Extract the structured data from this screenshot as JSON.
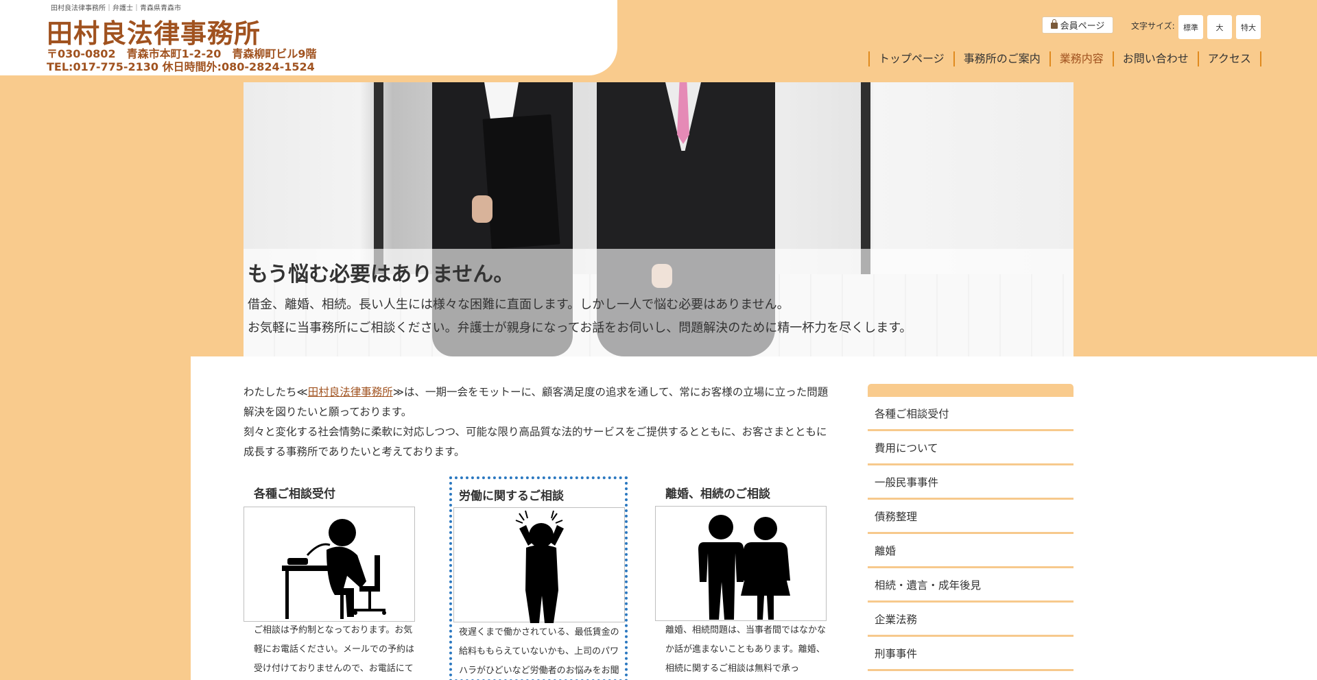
{
  "header": {
    "tagline": "田村良法律事務所｜弁護士｜青森県青森市",
    "title": "田村良法律事務所",
    "address": "〒030-0802　青森市本町1-2-20　青森柳町ビル9階",
    "tel": "TEL:017-775-2130 休日時間外:080-2824-1524",
    "member_label": "会員ページ",
    "font_size_label": "文字サイズ:",
    "font_sizes": [
      "標準",
      "大",
      "特大"
    ]
  },
  "nav": [
    "トップページ",
    "事務所のご案内",
    "業務内容",
    "お問い合わせ",
    "アクセス"
  ],
  "hero": {
    "heading": "もう悩む必要はありません。",
    "line1": "借金、離婚、相続。長い人生には様々な困難に直面します。しかし一人で悩む必要はありません。",
    "line2": "お気軽に当事務所にご相談ください。弁護士が親身になってお話をお伺いし、問題解決のために精一杯力を尽くします。"
  },
  "intro": {
    "pre": "わたしたち≪",
    "link": "田村良法律事務所",
    "post": "≫は、一期一会をモットーに、顧客満足度の追求を通して、常にお客様の立場に立った問題解決を図りたいと願っております。",
    "p2": "刻々と変化する社会情勢に柔軟に対応しつつ、可能な限り高品質な法的サービスをご提供するとともに、お客さまとともに成長する事務所でありたいと考えております。"
  },
  "cards": [
    {
      "title": "各種ご相談受付",
      "text": "ご相談は予約制となっております。お気軽にお電話ください。メールでの予約は受け付けておりませんので、お電話にて"
    },
    {
      "title": "労働に関するご相談",
      "text": "夜遅くまで働かされている、最低賃金の給料ももらえていないかも、上司のパワハラがひどいなど労働者のお悩みをお聞"
    },
    {
      "title": "離婚、相続のご相談",
      "text": "離婚、相続問題は、当事者間ではなかなか話が進まないこともあります。離婚、相続に関するご相談は無料で承っ"
    }
  ],
  "sidebar": [
    "各種ご相談受付",
    "費用について",
    "一般民事事件",
    "債務整理",
    "離婚",
    "相続・遺言・成年後見",
    "企業法務",
    "刑事事件"
  ]
}
